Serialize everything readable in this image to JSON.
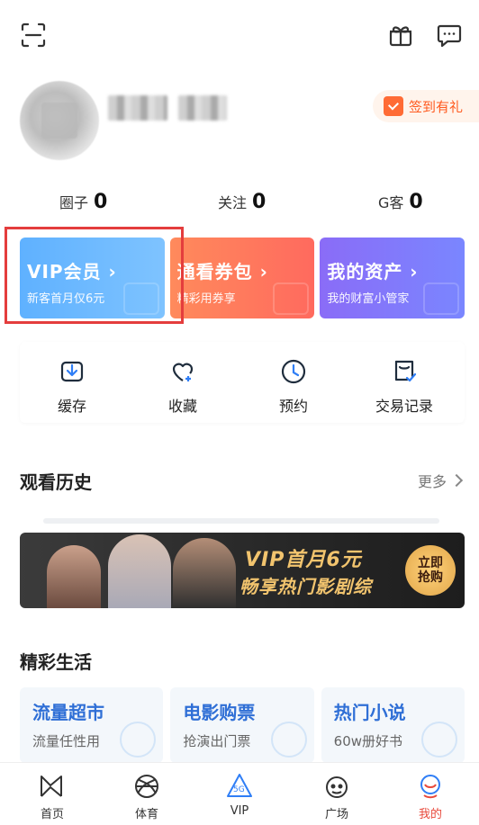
{
  "top_bar": {
    "scan_icon": "scan-icon",
    "gift_icon": "gift-icon",
    "message_icon": "message-icon"
  },
  "profile": {
    "signin_label": "签到有礼"
  },
  "stats": [
    {
      "label": "圈子",
      "value": "0"
    },
    {
      "label": "关注",
      "value": "0"
    },
    {
      "label": "G客",
      "value": "0"
    }
  ],
  "cards": [
    {
      "title": "VIP会员 ›",
      "sub": "新客首月仅6元"
    },
    {
      "title": "通看券包 ›",
      "sub": "精彩用券享"
    },
    {
      "title": "我的资产 ›",
      "sub": "我的财富小管家"
    }
  ],
  "quick_actions": [
    {
      "label": "缓存",
      "icon": "download-icon"
    },
    {
      "label": "收藏",
      "icon": "favorite-icon"
    },
    {
      "label": "预约",
      "icon": "clock-icon"
    },
    {
      "label": "交易记录",
      "icon": "receipt-icon"
    }
  ],
  "history": {
    "title": "观看历史",
    "more": "更多"
  },
  "banner": {
    "line1": "VIP首月6元",
    "line2": "畅享热门影剧综",
    "cta": "立即\n抢购"
  },
  "life": {
    "title": "精彩生活",
    "tiles": [
      {
        "title": "流量超市",
        "sub": "流量任性用"
      },
      {
        "title": "电影购票",
        "sub": "抢演出门票"
      },
      {
        "title": "热门小说",
        "sub": "60w册好书"
      }
    ]
  },
  "nav": [
    {
      "label": "首页",
      "icon": "home-icon"
    },
    {
      "label": "体育",
      "icon": "basketball-icon"
    },
    {
      "label": "VIP",
      "icon": "5g-vip-icon"
    },
    {
      "label": "广场",
      "icon": "plaza-icon"
    },
    {
      "label": "我的",
      "icon": "profile-icon"
    }
  ],
  "colors": {
    "vip_card": "#6ab8ff",
    "ticket_card": "#ff7b5d",
    "assets_card": "#8677fb",
    "accent_red": "#e84a3c",
    "signin_orange": "#ff5a1f",
    "life_blue": "#2f6fd6"
  }
}
